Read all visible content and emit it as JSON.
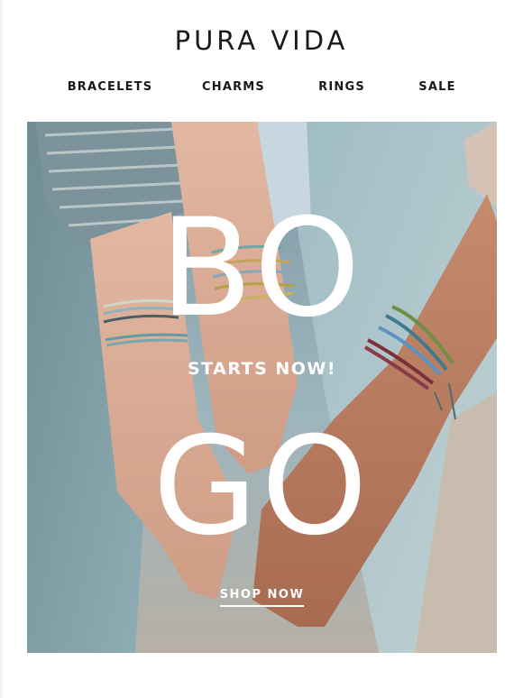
{
  "brand": {
    "name": "PURA VIDA"
  },
  "nav": {
    "items": [
      {
        "label": "BRACELETS"
      },
      {
        "label": "CHARMS"
      },
      {
        "label": "RINGS"
      },
      {
        "label": "SALE"
      }
    ]
  },
  "hero": {
    "headline_top": "BO",
    "headline_bottom": "GO",
    "subheadline": "STARTS NOW!",
    "cta_label": "SHOP NOW",
    "image_description_icon": "hands-with-bracelets-photo"
  },
  "colors": {
    "text": "#1a1a1a",
    "hero_text": "#ffffff",
    "denim": "#8fa9b3",
    "skin_light": "#d9ad97",
    "skin_tan": "#b9785d"
  }
}
